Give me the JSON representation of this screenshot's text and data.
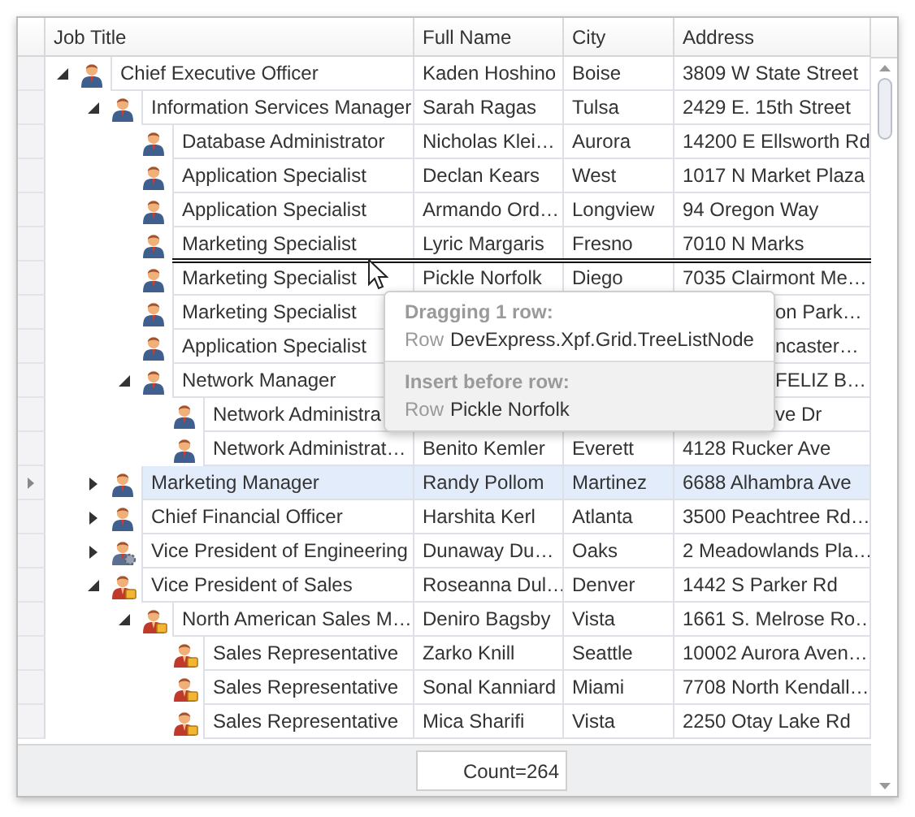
{
  "columns": [
    "Job Title",
    "Full Name",
    "City",
    "Address"
  ],
  "tree": [
    {
      "title": "Chief Executive Officer",
      "full_name": "Kaden Hoshino",
      "city": "Boise",
      "address": "3809 W State Street",
      "kind": "staff",
      "selected": false,
      "insert_before": false,
      "expanded": true,
      "children": [
        {
          "title": "Information Services Manager",
          "full_name": "Sarah Ragas",
          "city": "Tulsa",
          "address": "2429 E. 15th Street",
          "kind": "staff",
          "selected": false,
          "insert_before": false,
          "expanded": true,
          "children": [
            {
              "title": "Database Administrator",
              "full_name": "Nicholas Klei…",
              "city": "Aurora",
              "address": "14200 E Ellsworth Rd",
              "kind": "staff",
              "selected": false,
              "insert_before": false
            },
            {
              "title": "Application Specialist",
              "full_name": "Declan Kears",
              "city": "West",
              "address": "1017 N Market Plaza",
              "kind": "staff",
              "selected": false,
              "insert_before": false
            },
            {
              "title": "Application Specialist",
              "full_name": "Armando Ord…",
              "city": "Longview",
              "address": "94 Oregon Way",
              "kind": "staff",
              "selected": false,
              "insert_before": false
            },
            {
              "title": "Marketing Specialist",
              "full_name": "Lyric Margaris",
              "city": "Fresno",
              "address": "7010 N Marks",
              "kind": "staff",
              "selected": false,
              "insert_before": false
            },
            {
              "title": "Marketing Specialist",
              "full_name": "Pickle Norfolk",
              "city": "Diego",
              "address": "7035 Clairmont Me…",
              "kind": "staff",
              "selected": false,
              "insert_before": true
            },
            {
              "title": "Marketing Specialist",
              "address": {
                "text": "on Park…",
                "covered_start": true
              },
              "kind": "staff",
              "selected": false,
              "insert_before": false
            },
            {
              "title": "Application Specialist",
              "address": {
                "text": "ncaster…",
                "covered_start": true
              },
              "kind": "staff",
              "selected": false,
              "insert_before": false
            },
            {
              "title": "Network Manager",
              "address": {
                "text": "FELIZ B…",
                "covered_start": true
              },
              "kind": "staff",
              "selected": false,
              "insert_before": false,
              "expanded": true,
              "children": [
                {
                  "title": "Network Administra",
                  "address": {
                    "text": "ve Dr",
                    "covered_start": true
                  },
                  "kind": "staff",
                  "selected": false,
                  "insert_before": false
                },
                {
                  "title": "Network Administrat…",
                  "full_name": "Benito Kemler",
                  "city": "Everett",
                  "address": "4128 Rucker Ave",
                  "kind": "staff",
                  "selected": false,
                  "insert_before": false
                }
              ]
            }
          ]
        },
        {
          "title": "Marketing Manager",
          "full_name": "Randy Pollom",
          "city": "Martinez",
          "address": "6688 Alhambra Ave",
          "kind": "staff",
          "selected": true,
          "insert_before": false,
          "expanded": false
        },
        {
          "title": "Chief Financial Officer",
          "full_name": "Harshita Kerl",
          "city": "Atlanta",
          "address": "3500 Peachtree Rd…",
          "kind": "staff",
          "selected": false,
          "insert_before": false,
          "expanded": false
        },
        {
          "title": "Vice President of Engineering",
          "full_name": "Dunaway Du…",
          "city": "Oaks",
          "address": "2 Meadowlands Pla…",
          "kind": "engineering",
          "selected": false,
          "insert_before": false,
          "expanded": false
        },
        {
          "title": "Vice President of Sales",
          "full_name": "Roseanna Dul…",
          "city": "Denver",
          "address": "1442 S Parker Rd",
          "kind": "sales",
          "selected": false,
          "insert_before": false,
          "expanded": true,
          "children": [
            {
              "title": "North American Sales M…",
              "full_name": "Deniro Bagsby",
              "city": "Vista",
              "address": "1661 S. Melrose Ro…",
              "kind": "sales",
              "selected": false,
              "insert_before": false,
              "expanded": true,
              "children": [
                {
                  "title": "Sales Representative",
                  "full_name": "Zarko Knill",
                  "city": "Seattle",
                  "address": "10002 Aurora Aven…",
                  "kind": "sales",
                  "selected": false,
                  "insert_before": false
                },
                {
                  "title": "Sales Representative",
                  "full_name": "Sonal Kanniard",
                  "city": "Miami",
                  "address": "7708 North Kendall…",
                  "kind": "sales",
                  "selected": false,
                  "insert_before": false
                },
                {
                  "title": "Sales Representative",
                  "full_name": "Mica Sharifi",
                  "city": "Vista",
                  "address": "2250 Otay Lake Rd",
                  "kind": "sales",
                  "selected": false,
                  "insert_before": false
                }
              ]
            }
          ]
        }
      ]
    }
  ],
  "summary": "Count=264",
  "drag_tooltip": [
    {
      "heading": "Dragging 1 row:",
      "label": "Row",
      "value": "DevExpress.Xpf.Grid.TreeListNode",
      "shaded": false
    },
    {
      "heading": "Insert before row:",
      "label": "Row",
      "value": "Pickle Norfolk",
      "shaded": true
    }
  ]
}
